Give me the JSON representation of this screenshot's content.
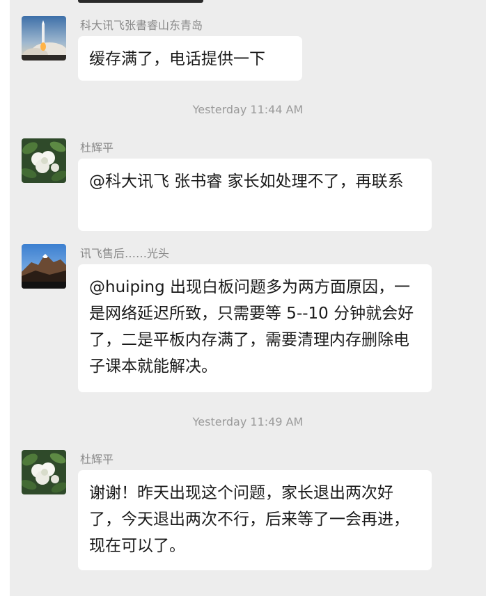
{
  "messages": [
    {
      "sender": "科大讯飞张書睿山东青岛",
      "avatar": "rocket-launch-avatar-icon",
      "text": "缓存满了，电话提供一下"
    },
    {
      "sender": "杜辉平",
      "avatar": "white-flower-avatar-icon",
      "text": "@科大讯飞 张书睿  家长如处理不了，再联系"
    },
    {
      "sender": "讯飞售后……光头",
      "avatar": "mountain-avatar-icon",
      "text": "@huiping 出现白板问题多为两方面原因，一是网络延迟所致，只需要等 5--10 分钟就会好了，二是平板内存满了，需要清理内存删除电子课本就能解决。"
    },
    {
      "sender": "杜辉平",
      "avatar": "white-flower-avatar-icon",
      "text": "谢谢！昨天出现这个问题，家长退出两次好了，今天退出两次不行，后来等了一会再进，现在可以了。"
    }
  ],
  "timestamps": [
    "Yesterday 11:44 AM",
    "Yesterday 11:49 AM"
  ],
  "colors": {
    "background": "#ededed",
    "bubble": "#ffffff",
    "sender_text": "#8a8a8a",
    "timestamp_text": "#9a9a9a",
    "message_text": "#1a1a1a"
  }
}
